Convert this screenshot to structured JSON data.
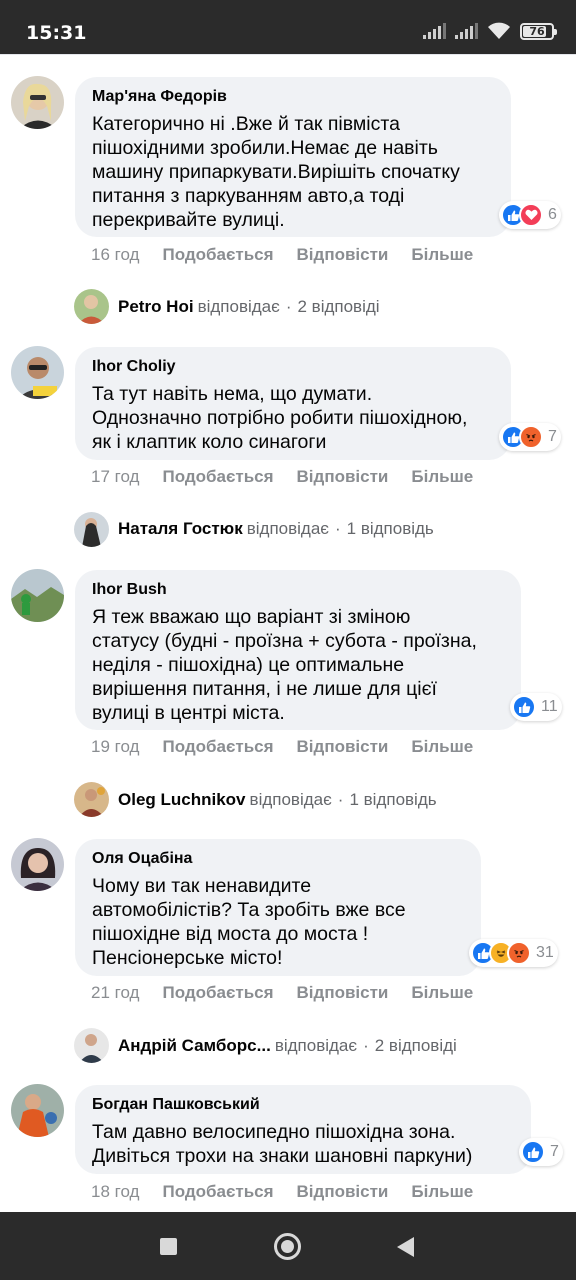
{
  "status_bar": {
    "time": "15:31",
    "battery": "76"
  },
  "actions": {
    "like": "Подобається",
    "reply": "Відповісти",
    "more": "Більше"
  },
  "comments": [
    {
      "author": "Мар'яна Федорів",
      "text": "Категорично ні .Вже й так півміста\nпішохідними зробили.Немає де навіть\nмашину припаркувати.Вирішіть спочатку\nпитання з паркуванням авто,а тоді\nперекривайте вулиці.",
      "time": "16 год",
      "reactions": [
        "like-icon",
        "love-icon"
      ],
      "reaction_count": "6",
      "reply": {
        "name": "Petro Hoi",
        "verb": "відповідає",
        "count": "2 відповіді"
      }
    },
    {
      "author": "Ihor Choliy",
      "text": "Та тут навіть нема, що думати.\nОднозначно потрібно робити пішохідною,\nяк і клаптик коло синагоги",
      "time": "17 год",
      "reactions": [
        "like-icon",
        "angry-icon"
      ],
      "reaction_count": "7",
      "reply": {
        "name": "Наталя Гостюк",
        "verb": "відповідає",
        "count": "1 відповідь"
      }
    },
    {
      "author": "Ihor Bush",
      "text": "Я теж вважаю що варіант зі зміною\nстатусу (будні - проїзна + субота - проїзна,\nнеділя - пішохідна) це оптимальне\nвирішення питання, і не лише для цієї\nвулиці в центрі міста.",
      "time": "19 год",
      "reactions": [
        "like-icon"
      ],
      "reaction_count": "11",
      "reply": {
        "name": "Oleg Luchnikov",
        "verb": "відповідає",
        "count": "1 відповідь"
      }
    },
    {
      "author": "Оля Оцабіна",
      "text": "Чому ви так ненавидите\nавтомобілістів? Та зробіть вже все\nпішохідне від моста до моста !\nПенсіонерське місто!",
      "time": "21 год",
      "reactions": [
        "like-icon",
        "haha-icon",
        "angry-icon"
      ],
      "reaction_count": "31",
      "reply": {
        "name": "Андрій Самборс...",
        "verb": "відповідає",
        "count": "2 відповіді"
      }
    },
    {
      "author": "Богдан Пашковський",
      "text": "Там давно велосипедно пішохідна зона.\nДивіться трохи на знаки шановні паркуни)",
      "time": "18 год",
      "reactions": [
        "like-icon"
      ],
      "reaction_count": "7"
    }
  ]
}
